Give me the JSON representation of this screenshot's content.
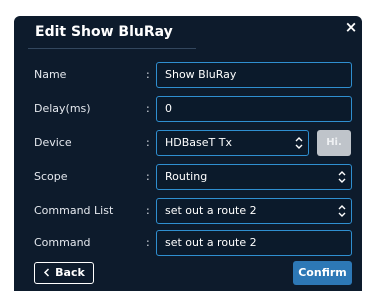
{
  "dialog": {
    "title": "Edit Show BluRay",
    "close_label": "×"
  },
  "form": {
    "separator": ":",
    "name": {
      "label": "Name",
      "value": "Show BluRay"
    },
    "delay": {
      "label": "Delay(ms)",
      "value": "0"
    },
    "device": {
      "label": "Device",
      "value": "HDBaseT Tx",
      "hi_label": "Hi."
    },
    "scope": {
      "label": "Scope",
      "value": "Routing"
    },
    "command_list": {
      "label": "Command List",
      "value": "set out a route 2"
    },
    "command": {
      "label": "Command",
      "value": "set out a route 2"
    }
  },
  "footer": {
    "back_label": "Back",
    "confirm_label": "Confirm"
  },
  "colors": {
    "dialog_bg": "#0d1b2c",
    "field_border": "#2f8fd0",
    "confirm_bg": "#2d78b6",
    "disabled_button": "#bfc4ca"
  },
  "icons": {
    "close": "close-icon",
    "select_arrows": "chevron-up-down-icon",
    "back": "chevron-left-icon"
  }
}
